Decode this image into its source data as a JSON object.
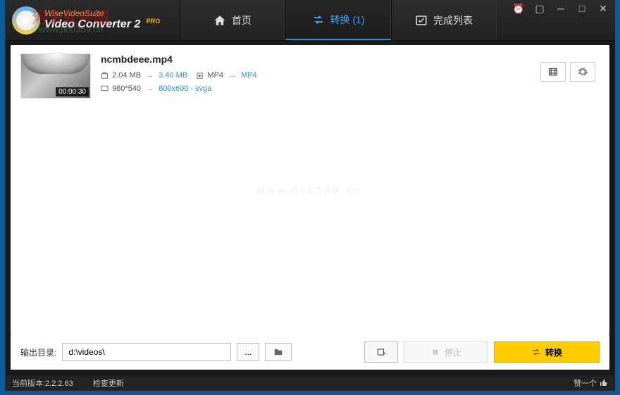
{
  "app": {
    "suite": "WiseVideoSuite",
    "title": "Video Converter 2",
    "edition": "PRO"
  },
  "watermark": {
    "line1": "河东软件园",
    "line2": "www.pc0359.cn",
    "center": "www.pc0359.cn"
  },
  "tabs": {
    "home": "首页",
    "convert": "转换 (1)",
    "completed": "完成列表"
  },
  "item": {
    "filename": "ncmbdeee.mp4",
    "duration": "00:00:30",
    "size_from": "2.04 MB",
    "size_to": "3.40 MB",
    "format_from": "MP4",
    "format_to": "MP4",
    "res_from": "960*540",
    "res_to": "800x600 - svga"
  },
  "footer": {
    "output_label": "输出目录:",
    "output_path": "d:\\videos\\",
    "browse": "...",
    "stop": "停止",
    "convert": "转换"
  },
  "status": {
    "version_label": "当前版本:",
    "version": "2.2.2.63",
    "check_update": "检查更新",
    "like": "赞一个"
  }
}
